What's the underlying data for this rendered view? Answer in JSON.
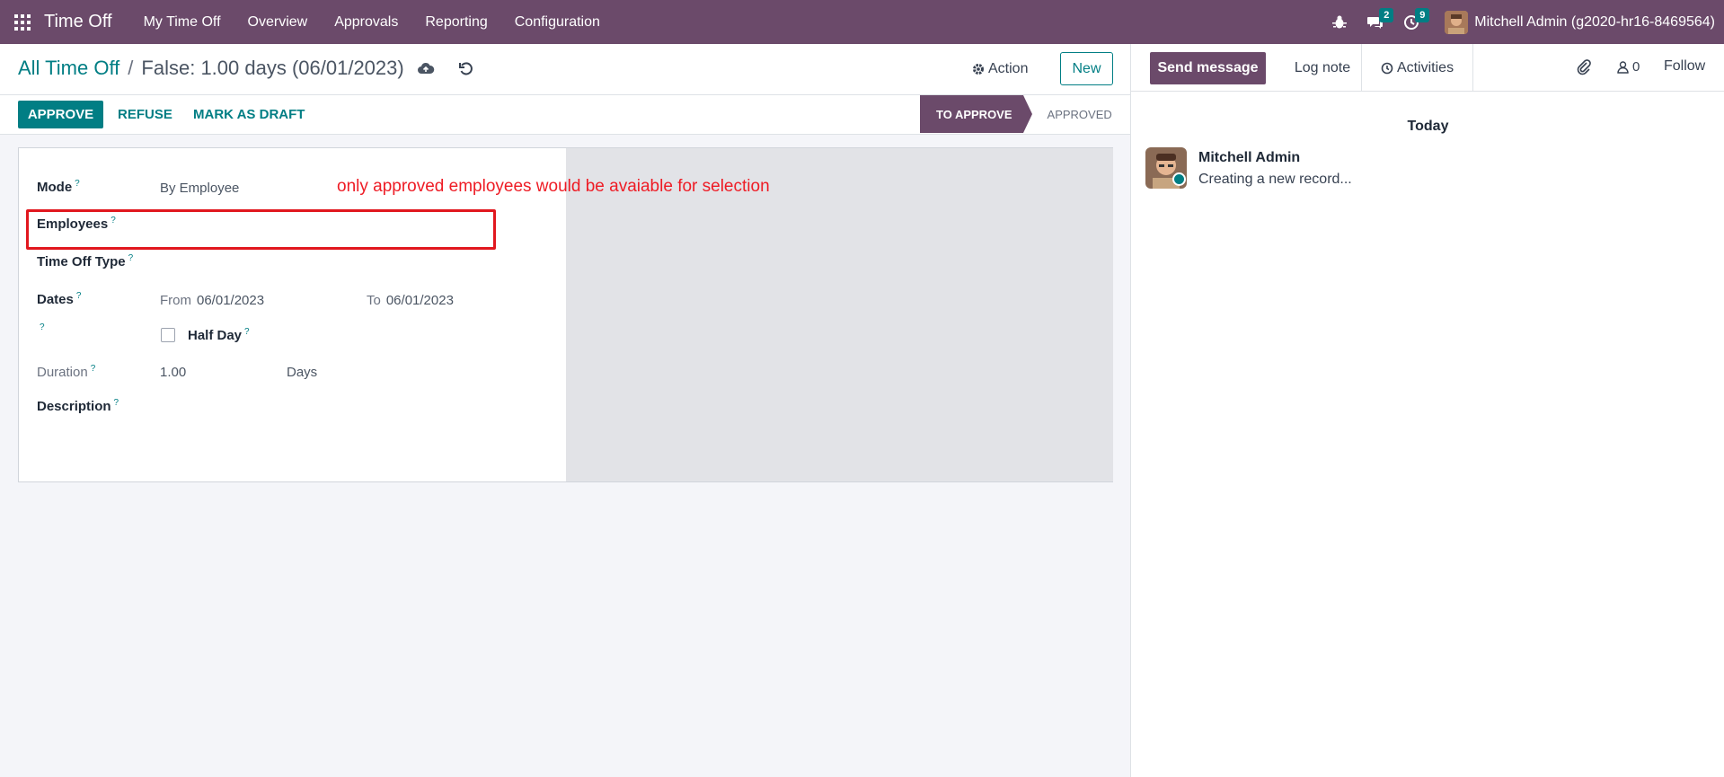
{
  "navbar": {
    "app_name": "Time Off",
    "menu": [
      "My Time Off",
      "Overview",
      "Approvals",
      "Reporting",
      "Configuration"
    ],
    "messages_count": "2",
    "activities_count": "9",
    "user": "Mitchell Admin (g2020-hr16-8469564)"
  },
  "breadcrumb": {
    "parent": "All Time Off",
    "separator": "/",
    "current": "False: 1.00 days (06/01/2023)"
  },
  "toolbar": {
    "action_label": "Action",
    "new_label": "New",
    "approve_label": "APPROVE",
    "refuse_label": "REFUSE",
    "draft_label": "MARK AS DRAFT"
  },
  "status": {
    "active": "TO APPROVE",
    "inactive": "APPROVED"
  },
  "form": {
    "mode_label": "Mode",
    "mode_value": "By Employee",
    "employees_label": "Employees",
    "time_off_type_label": "Time Off Type",
    "dates_label": "Dates",
    "from_label": "From",
    "from_value": "06/01/2023",
    "to_label": "To",
    "to_value": "06/01/2023",
    "half_day_label": "Half Day",
    "duration_label": "Duration",
    "duration_value": "1.00",
    "duration_unit": "Days",
    "description_label": "Description",
    "help_mark": "?"
  },
  "annotation": {
    "text": "only approved employees would be avaiable for selection",
    "color": "#ee1c25"
  },
  "chatter": {
    "send_message": "Send message",
    "log_note": "Log note",
    "activities": "Activities",
    "followers_count": "0",
    "follow": "Follow",
    "date_separator": "Today",
    "message": {
      "author": "Mitchell Admin",
      "body": "Creating a new record..."
    }
  },
  "colors": {
    "brand": "#6b4a6a",
    "accent": "#017e84"
  }
}
